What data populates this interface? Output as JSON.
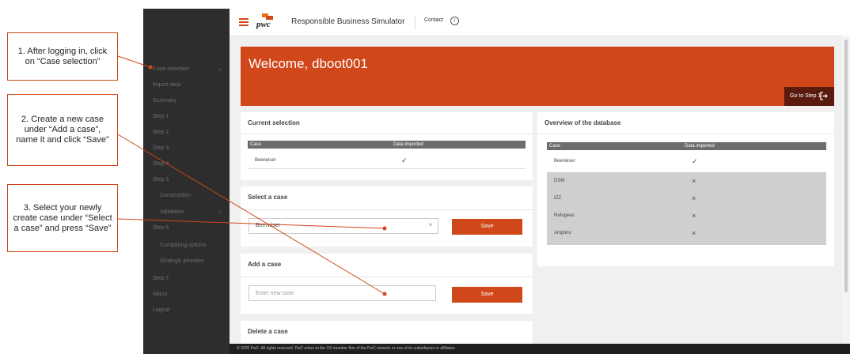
{
  "callouts": [
    "1. After logging in, click on “Case selection”",
    "2. Create a new case under “Add a case”, name it and click “Save”",
    "3. Select your newly create case under “Select a case” and press “Save”"
  ],
  "header": {
    "logo_text": "pwc",
    "title": "Responsible Business Simulator",
    "contact": "Contact",
    "info_glyph": "i"
  },
  "sidebar": {
    "items": [
      {
        "label": "Case selection",
        "has_arrow": true
      },
      {
        "label": "Import data"
      },
      {
        "label": "Summary"
      },
      {
        "label": "Step 1"
      },
      {
        "label": "Step 2"
      },
      {
        "label": "Step 3"
      },
      {
        "label": "Step 4"
      },
      {
        "label": "Step 5"
      },
      {
        "label": "Construction",
        "sub": true
      },
      {
        "label": "Validation",
        "sub": true,
        "has_arrow": true
      },
      {
        "label": "Step 6"
      },
      {
        "label": "Comparing options",
        "sub": true
      },
      {
        "label": "Strategic priorities",
        "sub": true
      },
      {
        "label": "Step 7"
      },
      {
        "label": "About"
      },
      {
        "label": "Logout"
      }
    ],
    "arrow_glyph": "›"
  },
  "banner": {
    "welcome": "Welcome, dboot001",
    "goto_label": "Go to Step 1"
  },
  "current_selection": {
    "title": "Current selection",
    "columns": [
      "Case",
      "Data imported"
    ],
    "rows": [
      {
        "case": "Beerwiser",
        "mark": "✓"
      }
    ]
  },
  "select_case": {
    "title": "Select a case",
    "selected": "Beerwiser",
    "chevron": "˅",
    "save_label": "Save"
  },
  "add_case": {
    "title": "Add a case",
    "placeholder": "Enter new case",
    "save_label": "Save"
  },
  "delete_case": {
    "title": "Delete a case"
  },
  "overview": {
    "title": "Overview of the database",
    "columns": [
      "Case",
      "Data imported"
    ],
    "rows": [
      {
        "case": "Beerwiser",
        "mark": "✓"
      },
      {
        "case": "DSM",
        "mark": "×"
      },
      {
        "case": "IZZ",
        "mark": "×"
      },
      {
        "case": "Refugees",
        "mark": "×"
      },
      {
        "case": "Amplino",
        "mark": "×"
      }
    ]
  },
  "footer": {
    "text": "© 2020 PwC. All rights reserved. PwC refers to the US member firm of the PwC network or one of its subsidiaries or affiliates."
  },
  "colors": {
    "accent": "#d0471a",
    "sidebar": "#2d2d2d",
    "goto_button": "#5a1a0e"
  }
}
